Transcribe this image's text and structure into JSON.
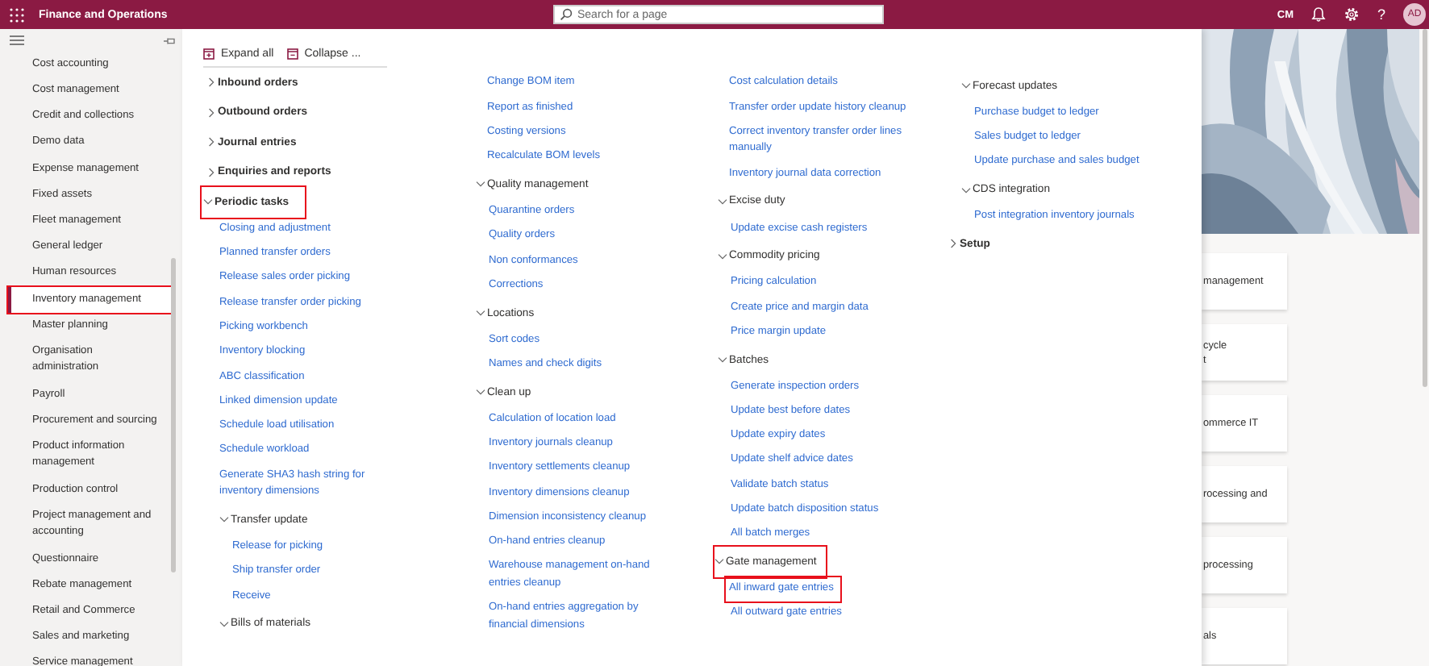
{
  "app_bar": {
    "title": "Finance and Operations",
    "search": {
      "placeholder": "Search for a page"
    },
    "company": "CM",
    "help": "?",
    "avatar": "AD"
  },
  "sidebar": {
    "items": [
      {
        "label": "Cost accounting",
        "selected": false,
        "highlighted": false
      },
      {
        "label": "Cost management",
        "selected": false,
        "highlighted": false
      },
      {
        "label": "Credit and collections",
        "selected": false,
        "highlighted": false
      },
      {
        "label": "Demo data",
        "selected": false,
        "highlighted": false
      },
      {
        "label": "Expense management",
        "selected": false,
        "highlighted": false
      },
      {
        "label": "Fixed assets",
        "selected": false,
        "highlighted": false
      },
      {
        "label": "Fleet management",
        "selected": false,
        "highlighted": false
      },
      {
        "label": "General ledger",
        "selected": false,
        "highlighted": false
      },
      {
        "label": "Human resources",
        "selected": false,
        "highlighted": false
      },
      {
        "label": "Inventory management",
        "selected": true,
        "highlighted": true
      },
      {
        "label": "Master planning",
        "selected": false,
        "highlighted": false
      },
      {
        "label": "Organisation\nadministration",
        "selected": false,
        "highlighted": false
      },
      {
        "label": "Payroll",
        "selected": false,
        "highlighted": false
      },
      {
        "label": "Procurement and sourcing",
        "selected": false,
        "highlighted": false
      },
      {
        "label": "Product information\nmanagement",
        "selected": false,
        "highlighted": false
      },
      {
        "label": "Production control",
        "selected": false,
        "highlighted": false
      },
      {
        "label": "Project management and\naccounting",
        "selected": false,
        "highlighted": false
      },
      {
        "label": "Questionnaire",
        "selected": false,
        "highlighted": false
      },
      {
        "label": "Rebate management",
        "selected": false,
        "highlighted": false
      },
      {
        "label": "Retail and Commerce",
        "selected": false,
        "highlighted": false
      },
      {
        "label": "Sales and marketing",
        "selected": false,
        "highlighted": false
      },
      {
        "label": "Service management",
        "selected": false,
        "highlighted": false
      }
    ]
  },
  "flyout": {
    "toolbar": [
      {
        "kind": "expand",
        "label": "Expand all"
      },
      {
        "kind": "collapse",
        "label": "Collapse ..."
      }
    ],
    "columns": [
      {
        "items": [
          {
            "kind": "section",
            "label": "Inbound orders",
            "expanded": false,
            "highlighted": false
          },
          {
            "kind": "section",
            "label": "Outbound orders",
            "expanded": false,
            "highlighted": false
          },
          {
            "kind": "section",
            "label": "Journal entries",
            "expanded": false,
            "highlighted": false
          },
          {
            "kind": "section",
            "label": "Enquiries and reports",
            "expanded": false,
            "highlighted": false
          },
          {
            "kind": "section",
            "label": "Periodic tasks",
            "expanded": true,
            "highlighted": true,
            "children": [
              {
                "kind": "link",
                "label": "Closing and adjustment",
                "highlighted": false
              },
              {
                "kind": "link",
                "label": "Planned transfer orders",
                "highlighted": false
              },
              {
                "kind": "link",
                "label": "Release sales order picking",
                "highlighted": false
              },
              {
                "kind": "link",
                "label": "Release transfer order picking",
                "highlighted": false
              },
              {
                "kind": "link",
                "label": "Picking workbench",
                "highlighted": false
              },
              {
                "kind": "link",
                "label": "Inventory blocking",
                "highlighted": false
              },
              {
                "kind": "link",
                "label": "ABC classification",
                "highlighted": false
              },
              {
                "kind": "link",
                "label": "Linked dimension update",
                "highlighted": false
              },
              {
                "kind": "link",
                "label": "Schedule load utilisation",
                "highlighted": false
              },
              {
                "kind": "link",
                "label": "Schedule workload",
                "highlighted": false
              },
              {
                "kind": "link",
                "label": "Generate SHA3 hash string for\ninventory dimensions",
                "highlighted": false
              },
              {
                "kind": "group",
                "label": "Transfer update",
                "expanded": true,
                "highlighted": false,
                "children": [
                  {
                    "kind": "link",
                    "label": "Release for picking",
                    "highlighted": false
                  },
                  {
                    "kind": "link",
                    "label": "Ship transfer order",
                    "highlighted": false
                  },
                  {
                    "kind": "link",
                    "label": "Receive",
                    "highlighted": false
                  }
                ]
              },
              {
                "kind": "group",
                "label": "Bills of materials",
                "expanded": true,
                "highlighted": false
              }
            ]
          }
        ]
      },
      {
        "items": [
          {
            "kind": "link",
            "label": "Change BOM item",
            "highlighted": false
          },
          {
            "kind": "link",
            "label": "Report as finished",
            "highlighted": false
          },
          {
            "kind": "link",
            "label": "Costing versions",
            "highlighted": false
          },
          {
            "kind": "link",
            "label": "Recalculate BOM levels",
            "highlighted": false
          },
          {
            "kind": "group",
            "label": "Quality management",
            "expanded": true,
            "highlighted": false,
            "children": [
              {
                "kind": "link",
                "label": "Quarantine orders",
                "highlighted": false
              },
              {
                "kind": "link",
                "label": "Quality orders",
                "highlighted": false
              },
              {
                "kind": "link",
                "label": "Non conformances",
                "highlighted": false
              },
              {
                "kind": "link",
                "label": "Corrections",
                "highlighted": false
              }
            ]
          },
          {
            "kind": "group",
            "label": "Locations",
            "expanded": true,
            "highlighted": false,
            "children": [
              {
                "kind": "link",
                "label": "Sort codes",
                "highlighted": false
              },
              {
                "kind": "link",
                "label": "Names and check digits",
                "highlighted": false
              }
            ]
          },
          {
            "kind": "group",
            "label": "Clean up",
            "expanded": true,
            "highlighted": false,
            "children": [
              {
                "kind": "link",
                "label": "Calculation of location load",
                "highlighted": false
              },
              {
                "kind": "link",
                "label": "Inventory journals cleanup",
                "highlighted": false
              },
              {
                "kind": "link",
                "label": "Inventory settlements cleanup",
                "highlighted": false
              },
              {
                "kind": "link",
                "label": "Inventory dimensions cleanup",
                "highlighted": false
              },
              {
                "kind": "link",
                "label": "Dimension inconsistency cleanup",
                "highlighted": false
              },
              {
                "kind": "link",
                "label": "On-hand entries cleanup",
                "highlighted": false
              },
              {
                "kind": "link",
                "label": "Warehouse management on-hand\nentries cleanup",
                "highlighted": false
              },
              {
                "kind": "link",
                "label": "On-hand entries aggregation by\nfinancial dimensions",
                "highlighted": false
              }
            ]
          }
        ]
      },
      {
        "items": [
          {
            "kind": "link",
            "label": "Cost calculation details",
            "highlighted": false
          },
          {
            "kind": "link",
            "label": "Transfer order update history cleanup",
            "highlighted": false
          },
          {
            "kind": "link",
            "label": "Correct inventory transfer order lines\nmanually",
            "highlighted": false
          },
          {
            "kind": "link",
            "label": "Inventory journal data correction",
            "highlighted": false
          },
          {
            "kind": "group",
            "label": "Excise duty",
            "expanded": true,
            "highlighted": false,
            "children": [
              {
                "kind": "link",
                "label": "Update excise cash registers",
                "highlighted": false
              }
            ]
          },
          {
            "kind": "group",
            "label": "Commodity pricing",
            "expanded": true,
            "highlighted": false,
            "children": [
              {
                "kind": "link",
                "label": "Pricing calculation",
                "highlighted": false
              },
              {
                "kind": "link",
                "label": "Create price and margin data",
                "highlighted": false
              },
              {
                "kind": "link",
                "label": "Price margin update",
                "highlighted": false
              }
            ]
          },
          {
            "kind": "group",
            "label": "Batches",
            "expanded": true,
            "highlighted": false,
            "children": [
              {
                "kind": "link",
                "label": "Generate inspection orders",
                "highlighted": false
              },
              {
                "kind": "link",
                "label": "Update best before dates",
                "highlighted": false
              },
              {
                "kind": "link",
                "label": "Update expiry dates",
                "highlighted": false
              },
              {
                "kind": "link",
                "label": "Update shelf advice dates",
                "highlighted": false
              },
              {
                "kind": "link",
                "label": "Validate batch status",
                "highlighted": false
              },
              {
                "kind": "link",
                "label": "Update batch disposition status",
                "highlighted": false
              },
              {
                "kind": "link",
                "label": "All batch merges",
                "highlighted": false
              }
            ]
          },
          {
            "kind": "group",
            "label": "Gate management",
            "expanded": true,
            "highlighted": true,
            "children": [
              {
                "kind": "link",
                "label": "All inward gate entries",
                "highlighted": true
              },
              {
                "kind": "link",
                "label": "All outward gate entries",
                "highlighted": false
              }
            ]
          }
        ]
      },
      {
        "items": [
          {
            "kind": "group",
            "label": "Forecast updates",
            "expanded": true,
            "highlighted": false,
            "children": [
              {
                "kind": "link",
                "label": "Purchase budget to ledger",
                "highlighted": false
              },
              {
                "kind": "link",
                "label": "Sales budget to ledger",
                "highlighted": false
              },
              {
                "kind": "link",
                "label": "Update purchase and sales budget",
                "highlighted": false
              }
            ]
          },
          {
            "kind": "group",
            "label": "CDS integration",
            "expanded": true,
            "highlighted": false,
            "children": [
              {
                "kind": "link",
                "label": "Post integration inventory journals",
                "highlighted": false
              }
            ]
          },
          {
            "kind": "section",
            "label": "Setup",
            "expanded": false,
            "highlighted": false
          }
        ]
      }
    ]
  },
  "workspace": {
    "tiles": [
      {
        "text": "management"
      },
      {
        "text": "cycle\nt"
      },
      {
        "text": "ommerce IT"
      },
      {
        "text": "rocessing and"
      },
      {
        "text": "processing"
      },
      {
        "text": "als"
      }
    ]
  }
}
